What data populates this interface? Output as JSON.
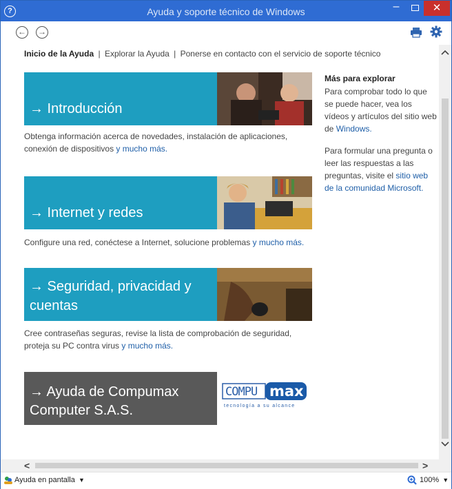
{
  "window": {
    "title": "Ayuda y soporte técnico de Windows",
    "help_glyph": "?",
    "minimize_glyph": "–",
    "close_glyph": "✕"
  },
  "toolbar": {
    "back_glyph": "←",
    "forward_glyph": "→"
  },
  "breadcrumb": {
    "home": "Inicio de la Ayuda",
    "separator": "|",
    "explore": "Explorar la Ayuda",
    "contact": "Ponerse en contacto con el servicio de soporte técnico"
  },
  "cards": [
    {
      "title": "→ Introducción",
      "desc": "Obtenga información acerca de novedades, instalación de aplicaciones, conexión de dispositivos",
      "more": "y mucho más."
    },
    {
      "title": "→ Internet y redes",
      "desc": "Configure una red, conéctese a Internet, solucione problemas",
      "more": "y mucho más."
    },
    {
      "title_line1": "→ Seguridad, privacidad y",
      "title_line2": "cuentas",
      "desc": "Cree contraseñas seguras, revise la lista de comprobación de seguridad, proteja su PC contra virus",
      "more": "y mucho más."
    }
  ],
  "compumax": {
    "title_line1": "→ Ayuda de Compumax",
    "title_line2": "Computer S.A.S.",
    "logo_left": "COMPU",
    "logo_right": "max",
    "logo_tagline": "tecnología a su alcance"
  },
  "aside": {
    "title": "Más para explorar",
    "p1_text": "Para comprobar todo lo que se puede hacer, vea los vídeos y artículos del sitio web de",
    "p1_link": "Windows.",
    "p2_text": "Para formular una pregunta o leer las respuestas a las preguntas, visite el",
    "p2_link": "sitio web de la comunidad Microsoft."
  },
  "scroll": {
    "left_glyph": "<",
    "right_glyph": ">",
    "up_glyph": "^",
    "down_glyph": "v"
  },
  "status": {
    "help_mode": "Ayuda en pantalla",
    "caret": "▼",
    "zoom": "100%"
  },
  "colors": {
    "titlebar": "#2f6cd3",
    "tile_blue": "#1e9ec0",
    "tile_gray": "#595959",
    "link": "#1f5fa8",
    "close_red": "#c9302c"
  }
}
